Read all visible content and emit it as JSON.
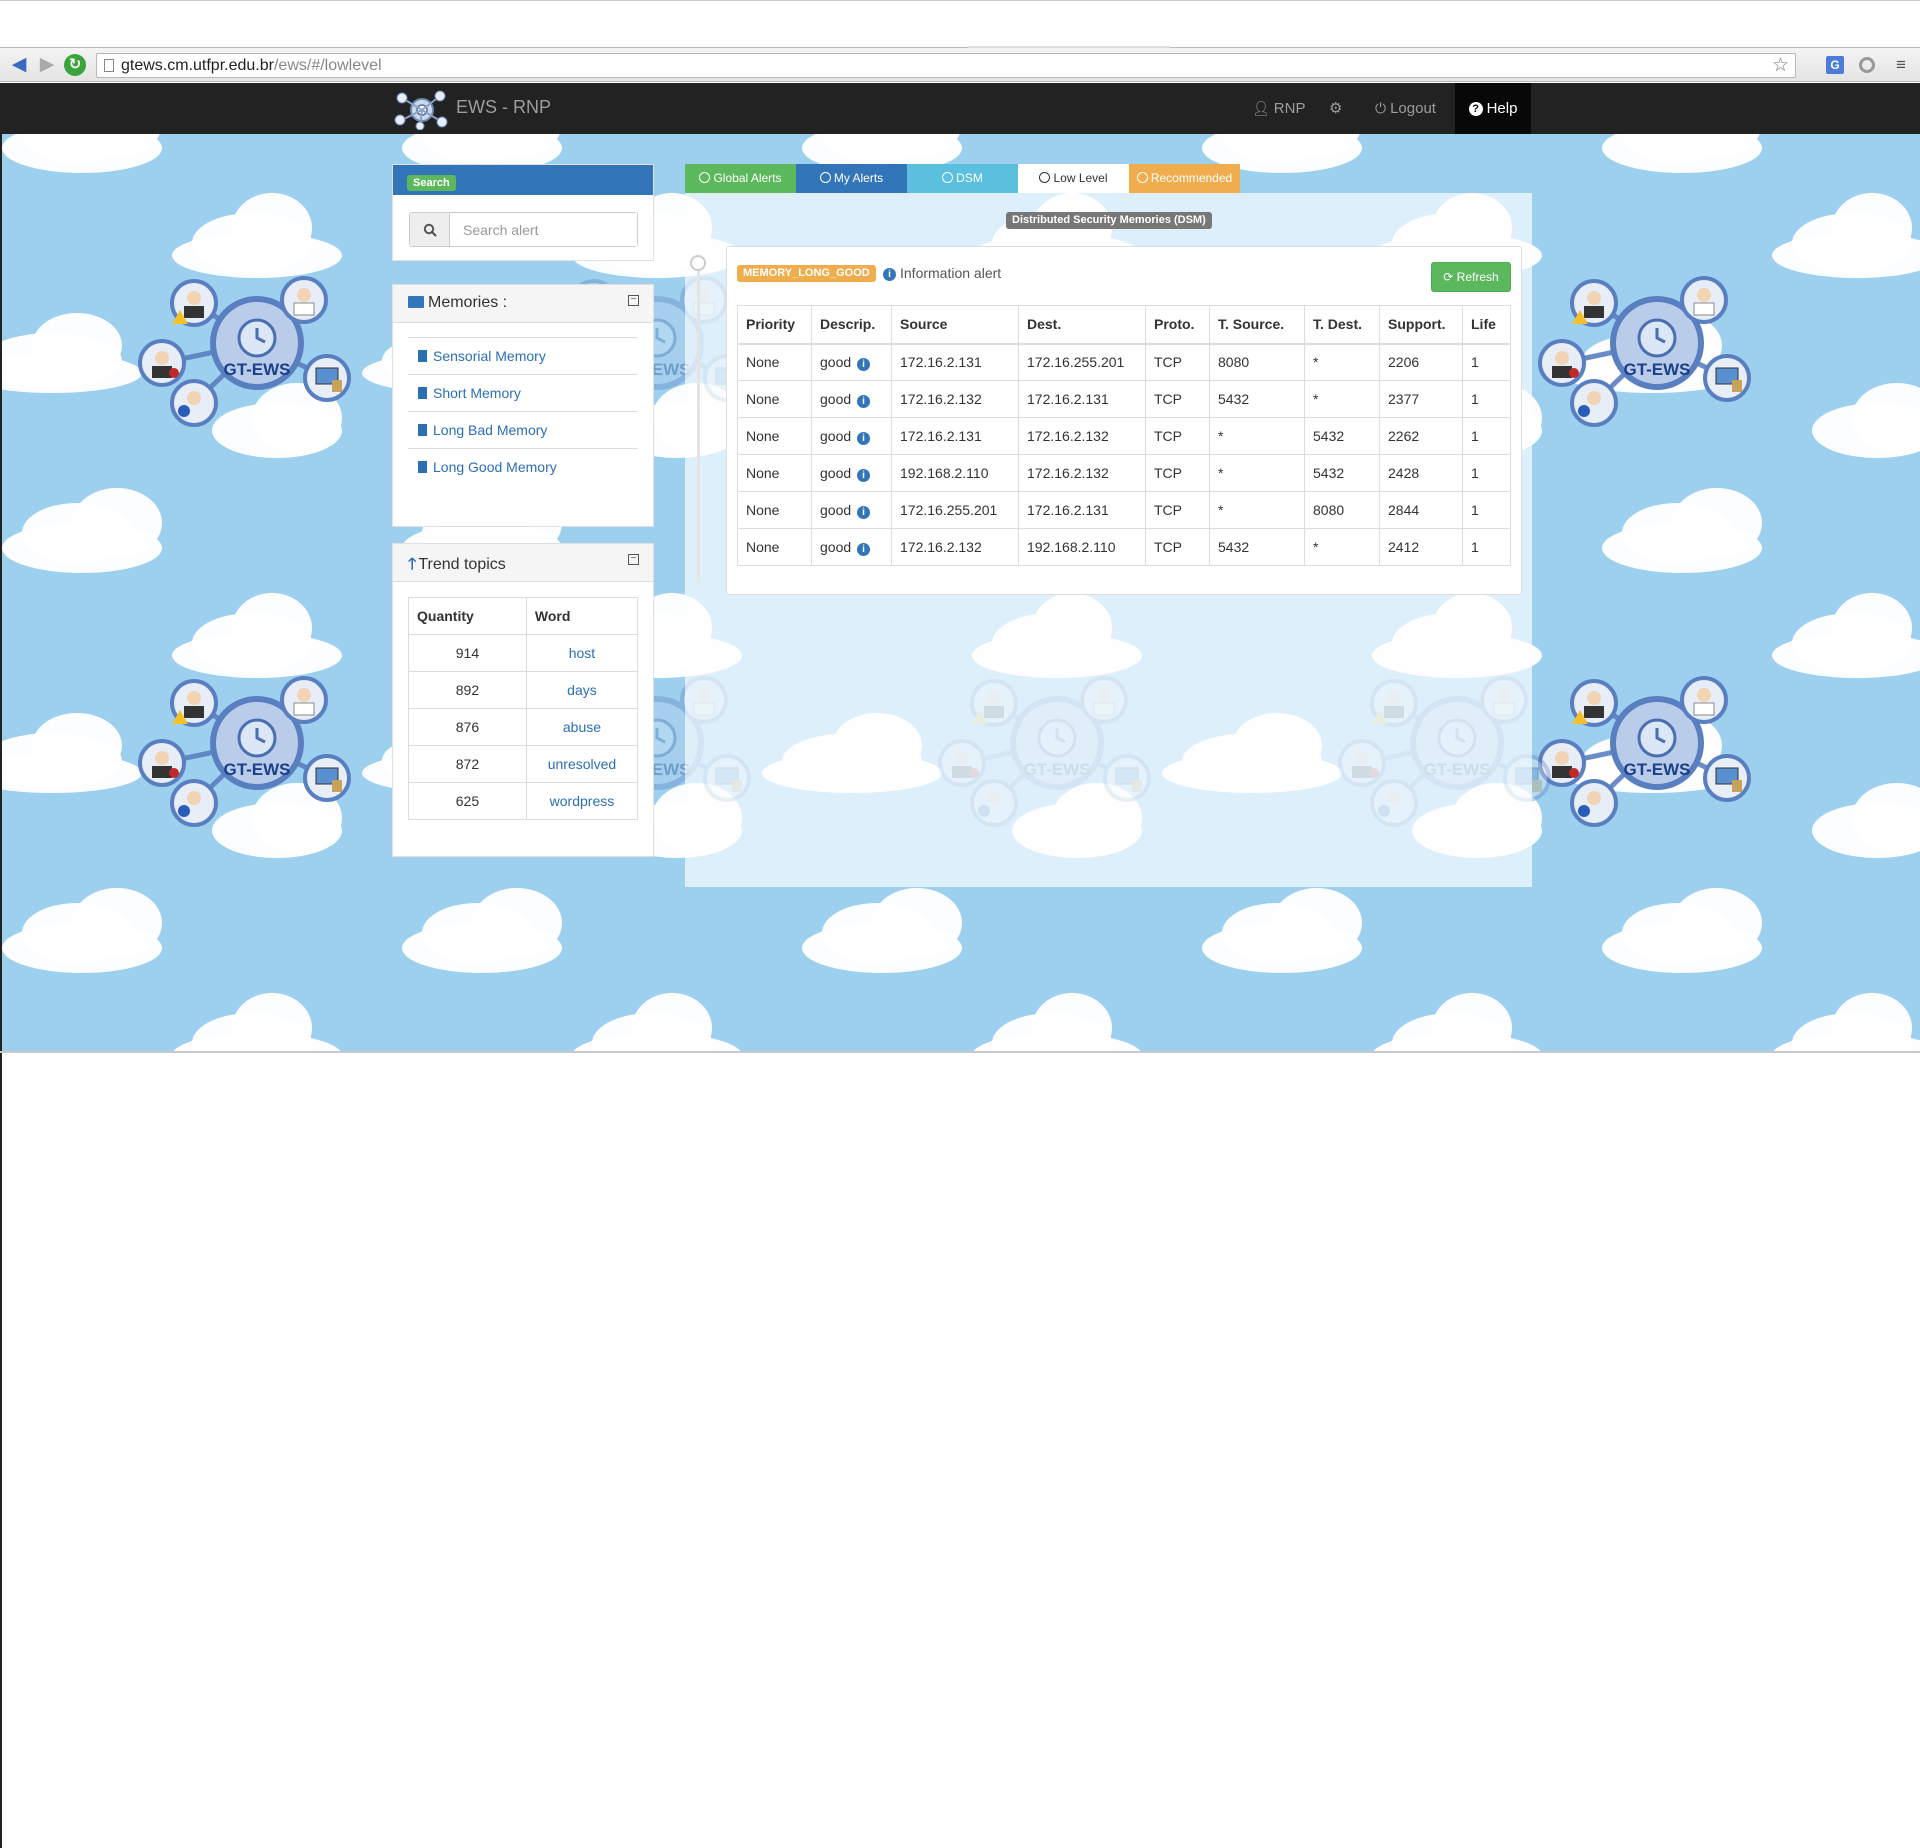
{
  "browser": {
    "url_host": "gtews.cm.utfpr.edu.br",
    "url_path": "/ews/#/lowlevel"
  },
  "navbar": {
    "brand": "EWS - RNP",
    "user": "RNP",
    "logout": "Logout",
    "help": "Help"
  },
  "hub_label": "GT-EWS",
  "search": {
    "badge": "Search",
    "placeholder": "Search alert"
  },
  "memories": {
    "title": "Memories :",
    "items": [
      {
        "label": "Sensorial Memory"
      },
      {
        "label": "Short Memory"
      },
      {
        "label": "Long Bad Memory"
      },
      {
        "label": "Long Good Memory"
      }
    ]
  },
  "trend": {
    "title": "Trend topics",
    "headers": [
      "Quantity",
      "Word"
    ],
    "rows": [
      {
        "quantity": "914",
        "word": "host"
      },
      {
        "quantity": "892",
        "word": "days"
      },
      {
        "quantity": "876",
        "word": "abuse"
      },
      {
        "quantity": "872",
        "word": "unresolved"
      },
      {
        "quantity": "625",
        "word": "wordpress"
      }
    ]
  },
  "tabs": [
    {
      "label": "Global Alerts"
    },
    {
      "label": "My Alerts"
    },
    {
      "label": "DSM"
    },
    {
      "label": "Low Level"
    },
    {
      "label": "Recommended"
    }
  ],
  "dsm_label": "Distributed Security Memories (DSM)",
  "alert": {
    "badge": "MEMORY_LONG_GOOD",
    "title": "Information alert",
    "refresh": "Refresh",
    "headers": [
      "Priority",
      "Descrip.",
      "Source",
      "Dest.",
      "Proto.",
      "T. Source.",
      "T. Dest.",
      "Support.",
      "Life"
    ],
    "rows": [
      [
        "None",
        "good",
        "172.16.2.131",
        "172.16.255.201",
        "TCP",
        "8080",
        "*",
        "2206",
        "1"
      ],
      [
        "None",
        "good",
        "172.16.2.132",
        "172.16.2.131",
        "TCP",
        "5432",
        "*",
        "2377",
        "1"
      ],
      [
        "None",
        "good",
        "172.16.2.131",
        "172.16.2.132",
        "TCP",
        "*",
        "5432",
        "2262",
        "1"
      ],
      [
        "None",
        "good",
        "192.168.2.110",
        "172.16.2.132",
        "TCP",
        "*",
        "5432",
        "2428",
        "1"
      ],
      [
        "None",
        "good",
        "172.16.255.201",
        "172.16.2.131",
        "TCP",
        "*",
        "8080",
        "2844",
        "1"
      ],
      [
        "None",
        "good",
        "172.16.2.132",
        "192.168.2.110",
        "TCP",
        "5432",
        "*",
        "2412",
        "1"
      ]
    ]
  },
  "colors": {
    "navbar": "#222222",
    "primary": "#3275b9",
    "success": "#5cb85c",
    "info": "#5bc0de",
    "warning": "#f0ad4e",
    "sky": "#9dd0ef"
  }
}
